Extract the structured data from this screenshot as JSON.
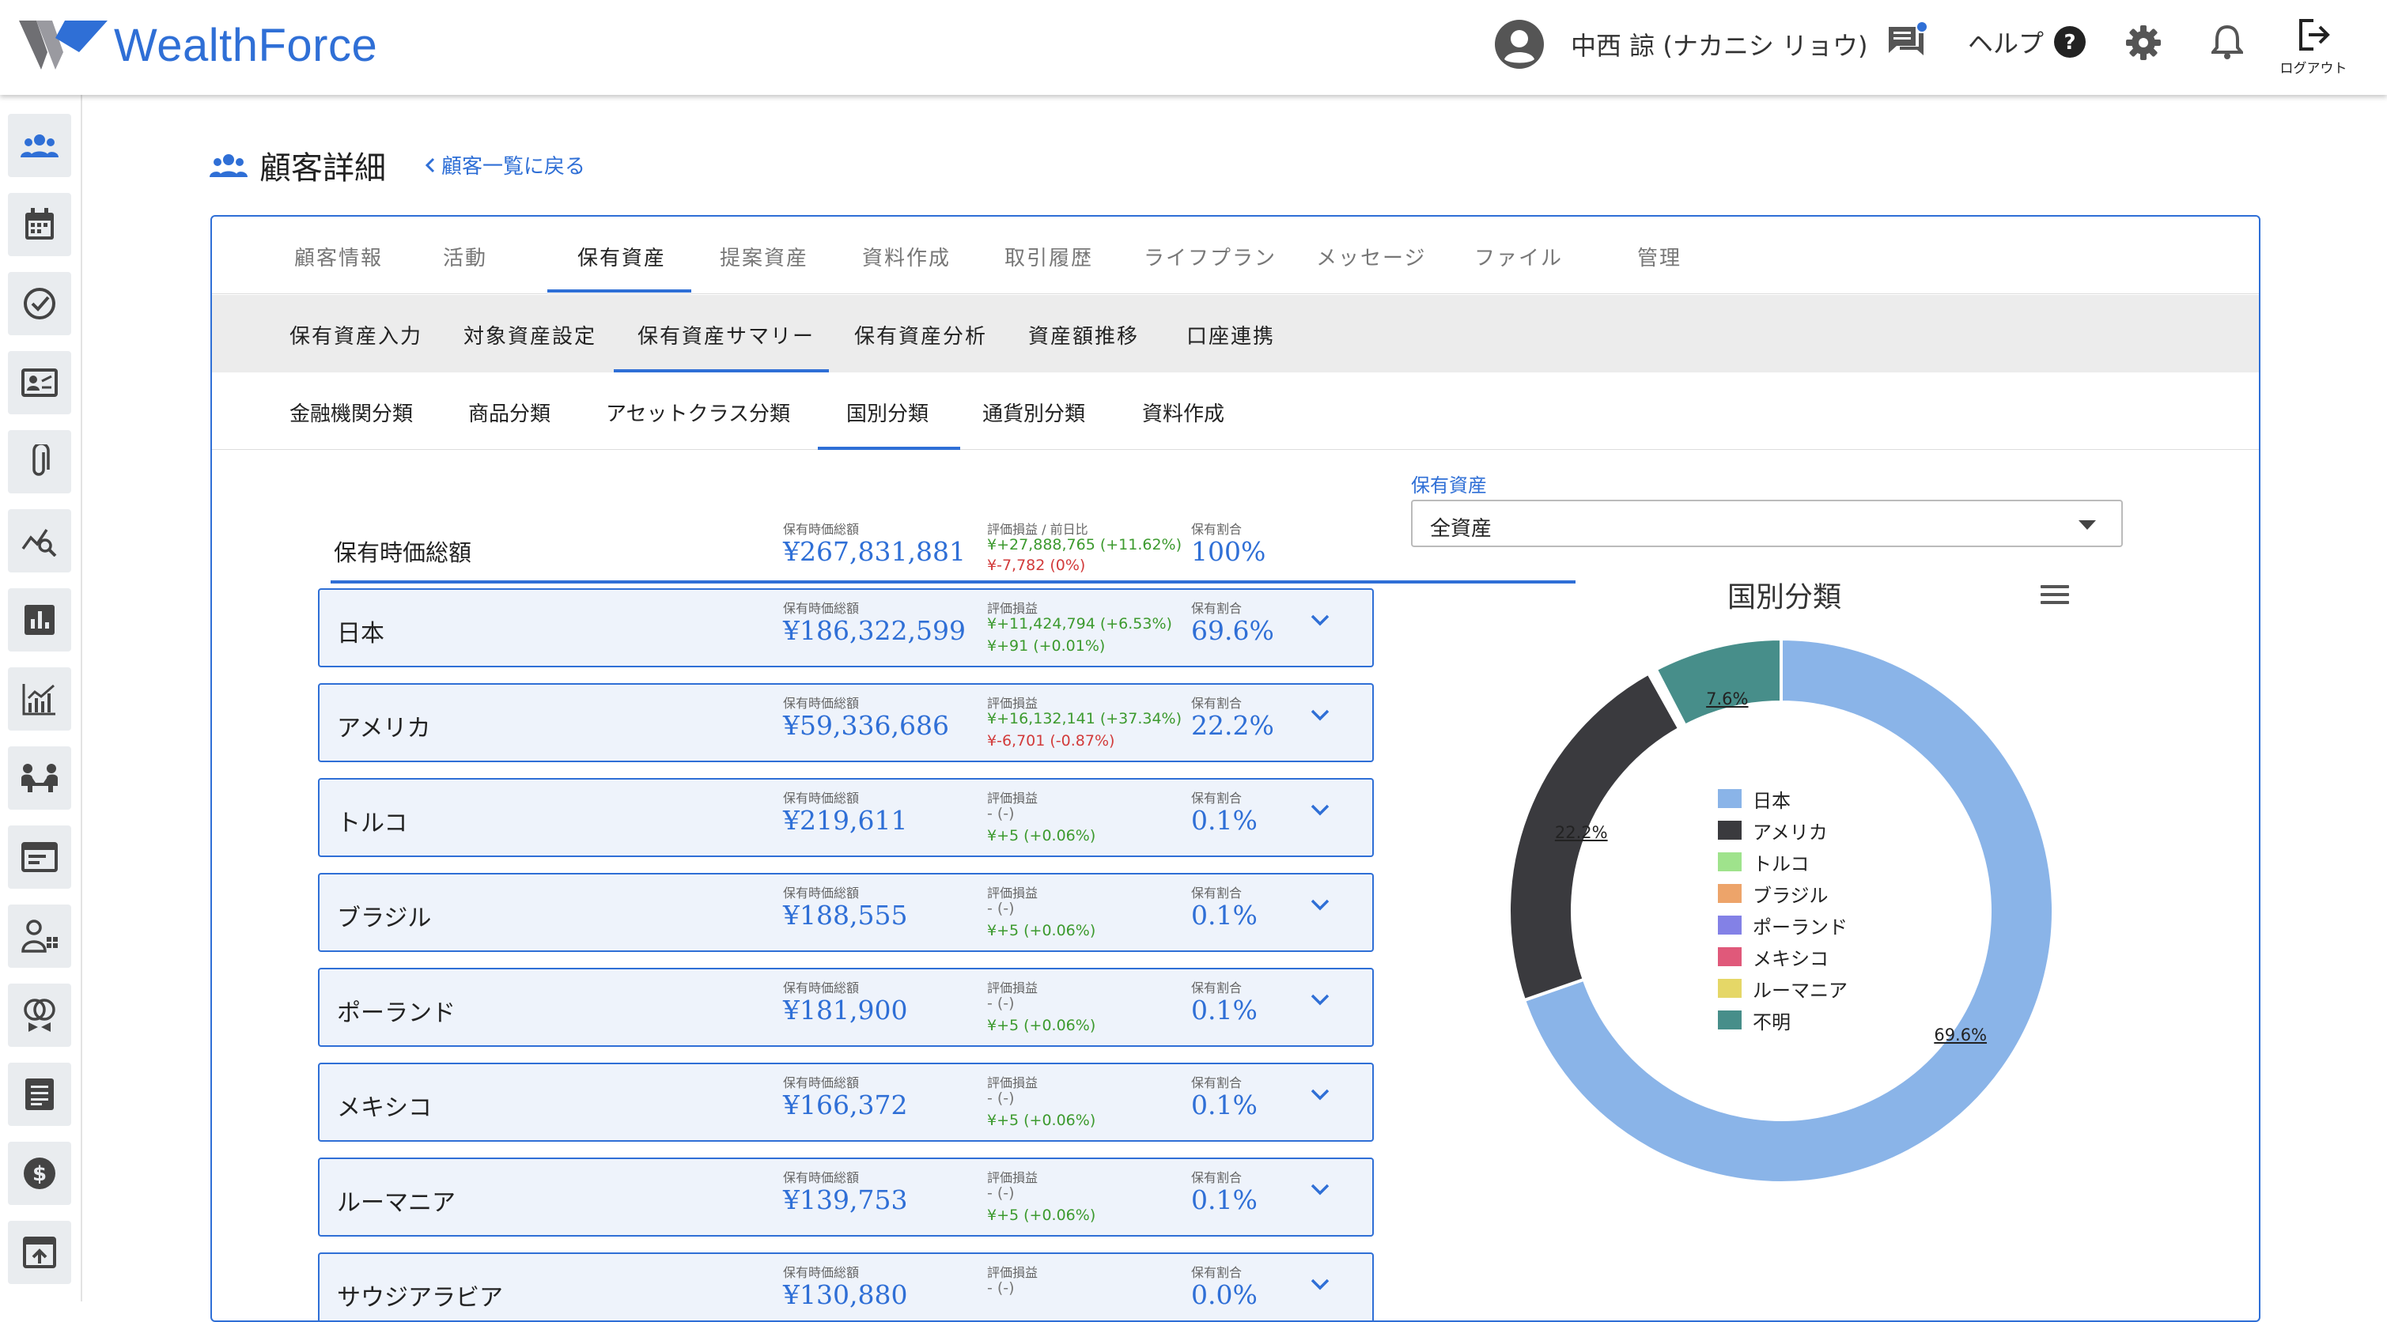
{
  "header": {
    "brand": "WealthForce",
    "user_name": "中西 諒 (ナカニシ リョウ)",
    "help_label": "ヘルプ",
    "logout_label": "ログアウト"
  },
  "page": {
    "title": "顧客詳細",
    "back_link": "顧客一覧に戻る"
  },
  "tabs_primary": [
    {
      "label": "顧客情報"
    },
    {
      "label": "活動"
    },
    {
      "label": "保有資産"
    },
    {
      "label": "提案資産"
    },
    {
      "label": "資料作成"
    },
    {
      "label": "取引履歴"
    },
    {
      "label": "ライフプラン"
    },
    {
      "label": "メッセージ"
    },
    {
      "label": "ファイル"
    },
    {
      "label": "管理"
    }
  ],
  "tabs_secondary": [
    {
      "label": "保有資産入力"
    },
    {
      "label": "対象資産設定"
    },
    {
      "label": "保有資産サマリー"
    },
    {
      "label": "保有資産分析"
    },
    {
      "label": "資産額推移"
    },
    {
      "label": "口座連携"
    }
  ],
  "tabs_tertiary": [
    {
      "label": "金融機関分類"
    },
    {
      "label": "商品分類"
    },
    {
      "label": "アセットクラス分類"
    },
    {
      "label": "国別分類"
    },
    {
      "label": "通貨別分類"
    },
    {
      "label": "資料作成"
    }
  ],
  "total": {
    "label": "保有時価総額",
    "value_caption": "保有時価総額",
    "value": "¥267,831,881",
    "pl_caption": "評価損益 / 前日比",
    "pl": "¥+27,888,765 (+11.62%)",
    "daily": "¥-7,782 (0%)",
    "ratio_caption": "保有割合",
    "ratio": "100%"
  },
  "captions": {
    "value": "保有時価総額",
    "pl": "評価損益",
    "ratio": "保有割合"
  },
  "rows": [
    {
      "name": "日本",
      "value": "¥186,322,599",
      "pl": "¥+11,424,794 (+6.53%)",
      "daily": "¥+91 (+0.01%)",
      "ratio": "69.6%"
    },
    {
      "name": "アメリカ",
      "value": "¥59,336,686",
      "pl": "¥+16,132,141 (+37.34%)",
      "daily": "¥-6,701 (-0.87%)",
      "ratio": "22.2%"
    },
    {
      "name": "トルコ",
      "value": "¥219,611",
      "pl": "- (-)",
      "daily": "¥+5 (+0.06%)",
      "ratio": "0.1%"
    },
    {
      "name": "ブラジル",
      "value": "¥188,555",
      "pl": "- (-)",
      "daily": "¥+5 (+0.06%)",
      "ratio": "0.1%"
    },
    {
      "name": "ポーランド",
      "value": "¥181,900",
      "pl": "- (-)",
      "daily": "¥+5 (+0.06%)",
      "ratio": "0.1%"
    },
    {
      "name": "メキシコ",
      "value": "¥166,372",
      "pl": "- (-)",
      "daily": "¥+5 (+0.06%)",
      "ratio": "0.1%"
    },
    {
      "name": "ルーマニア",
      "value": "¥139,753",
      "pl": "- (-)",
      "daily": "¥+5 (+0.06%)",
      "ratio": "0.1%"
    },
    {
      "name": "サウジアラビア",
      "value": "¥130,880",
      "pl": "- (-)",
      "daily": "",
      "ratio": "0.0%"
    }
  ],
  "filter": {
    "label": "保有資産",
    "value": "全資産"
  },
  "chart_data": {
    "type": "pie",
    "title": "国別分類",
    "hole": true,
    "legend_position": "center",
    "categories": [
      "日本",
      "アメリカ",
      "トルコ",
      "ブラジル",
      "ポーランド",
      "メキシコ",
      "ルーマニア",
      "不明"
    ],
    "values": [
      69.6,
      22.2,
      0.1,
      0.1,
      0.1,
      0.1,
      0.1,
      7.6
    ],
    "data_labels": [
      "69.6%",
      "22.2%",
      "",
      "",
      "",
      "",
      "",
      "7.6%"
    ],
    "colors": [
      "#8ab4e8",
      "#3a3a3e",
      "#9fe38c",
      "#eda46a",
      "#8381e6",
      "#e0597a",
      "#e5d767",
      "#478e8a"
    ]
  }
}
